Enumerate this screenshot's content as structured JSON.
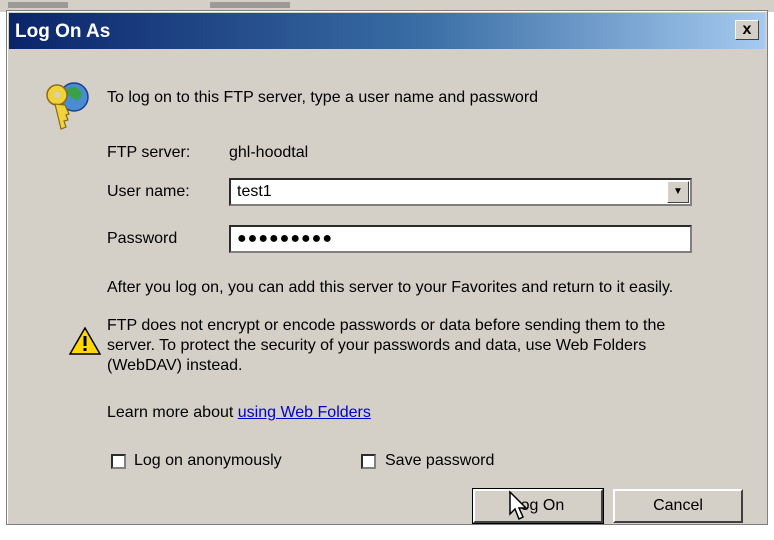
{
  "dialog": {
    "title": "Log On As",
    "close_label": "x",
    "intro": "To log on to this FTP server, type a user name and password",
    "ftp_server_label": "FTP server:",
    "ftp_server_value": "ghl-hoodtal",
    "user_name_label": "User name:",
    "user_name_value": "test1",
    "password_label": "Password",
    "password_value": "●●●●●●●●●",
    "favorites_note": "After you log on, you can add this server to your Favorites and return to it easily.",
    "warning_line1": "FTP does not encrypt or encode passwords or data before sending them to the",
    "warning_line2": "server. To protect the security of your passwords and data, use Web Folders",
    "warning_line3": "(WebDAV) instead.",
    "learn_more_prefix": "Learn more about",
    "learn_more_link": "using Web Folders",
    "anonymous_label": "Log on anonymously",
    "anonymous_checked": false,
    "save_password_label": "Save password",
    "save_password_checked": false,
    "logon_button": "Log On",
    "cancel_button": "Cancel"
  },
  "icons": {
    "key": "key-icon",
    "warning": "warning-icon",
    "dropdown": "chevron-down-icon",
    "cursor": "mouse-cursor-icon"
  },
  "colors": {
    "titlebar_start": "#0a246a",
    "titlebar_end": "#a6caf0",
    "dialog_face": "#d4d0c8",
    "link": "#0000cc"
  }
}
